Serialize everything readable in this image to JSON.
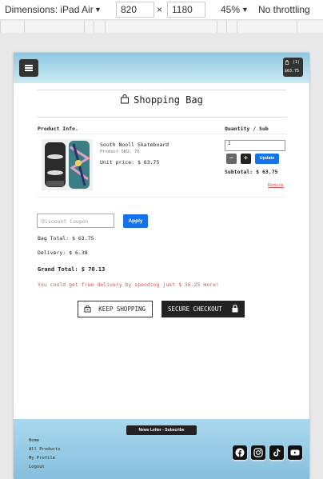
{
  "devtools": {
    "dimensions_label": "Dimensions: iPad Air",
    "width_value": "820",
    "times": "×",
    "height_value": "1180",
    "zoom": "45%",
    "throttling": "No throttling"
  },
  "nav": {
    "cart_count": "(1)",
    "cart_total": "$63.75"
  },
  "page": {
    "title": "Shopping Bag"
  },
  "table": {
    "col_product": "Product Info.",
    "col_qty": "Quantity / Sub"
  },
  "item": {
    "name": "South Nooll Skateboard",
    "sku": "Product SKU: 76",
    "unit_price": "Unit price: $ 63.75",
    "quantity": "1",
    "minus": "−",
    "plus": "+",
    "update_label": "Update",
    "subtotal": "Subtotal: $ 63.75",
    "remove_label": "Remove"
  },
  "summary": {
    "coupon_placeholder": "Discount Coupon",
    "apply_label": "Apply",
    "bag_total": "Bag Total: $ 63.75",
    "delivery": "Delivery: $ 6.38",
    "grand_total": "Grand Total: $ 70.13",
    "free_delivery_note": "You could get free delivery by spending just $ 36.25 more!"
  },
  "actions": {
    "keep_shopping": "KEEP SHOPPING",
    "secure_checkout": "SECURE CHECKOUT"
  },
  "footer": {
    "newsletter_label": "News Letter - Subscribe",
    "links": [
      "Home",
      "All Products",
      "My Profile",
      "Logout"
    ],
    "social_icons": [
      "facebook-icon",
      "instagram-icon",
      "tiktok-icon",
      "youtube-icon"
    ]
  },
  "colors": {
    "accent_blue": "#1572e8",
    "header_gradient_top": "#8ec7e0",
    "footer_blue": "#a9d8ee",
    "dark": "#222222",
    "warning_red": "#d9534f"
  }
}
